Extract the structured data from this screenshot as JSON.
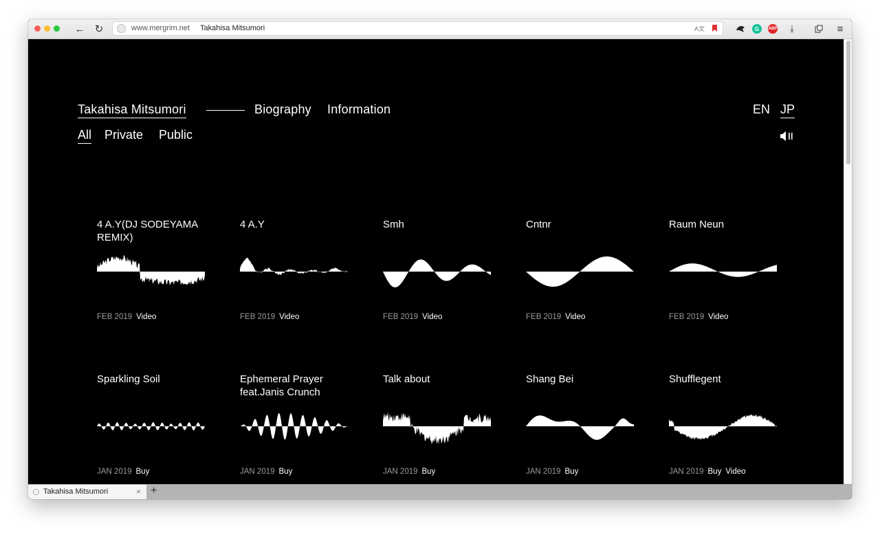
{
  "browser": {
    "url_domain": "www.mergrim.net",
    "url_title": "Takahisa Mitsumori",
    "translate_glyph": "A文",
    "ext_grammarly": "G",
    "ext_abp": "ABP",
    "tab_title": "Takahisa Mitsumori",
    "back_glyph": "←",
    "reload_glyph": "↻",
    "download_glyph": "⤓",
    "menu_glyph": "≡",
    "close_glyph": "×",
    "newtab_glyph": "+"
  },
  "nav": {
    "artist": "Takahisa Mitsumori",
    "biography": "Biography",
    "information": "Information",
    "lang_en": "EN",
    "lang_jp": "JP"
  },
  "filters": {
    "all": "All",
    "private": "Private",
    "public": "Public"
  },
  "colors": {
    "background": "#000000",
    "text": "#ffffff",
    "meta_date": "#9a9a9a"
  },
  "works": [
    {
      "title": "4 A.Y(DJ SODEYAMA REMIX)",
      "date": "FEB 2019",
      "tags": [
        "Video"
      ],
      "wave": "noisy-up-down"
    },
    {
      "title": "4 A.Y",
      "date": "FEB 2019",
      "tags": [
        "Video"
      ],
      "wave": "spiky-mixed"
    },
    {
      "title": "Smh",
      "date": "FEB 2019",
      "tags": [
        "Video"
      ],
      "wave": "decaying-sine"
    },
    {
      "title": "Cntnr",
      "date": "FEB 2019",
      "tags": [
        "Video"
      ],
      "wave": "inverted-sine"
    },
    {
      "title": "Raum Neun",
      "date": "FEB 2019",
      "tags": [
        "Video"
      ],
      "wave": "gentle-sine"
    },
    {
      "title": "Sparkling Soil",
      "date": "JAN 2019",
      "tags": [
        "Buy"
      ],
      "wave": "small-ripple"
    },
    {
      "title": "Ephemeral Prayer feat.Janis Crunch",
      "date": "JAN 2019",
      "tags": [
        "Buy"
      ],
      "wave": "amplitude-burst"
    },
    {
      "title": "Talk about",
      "date": "JAN 2019",
      "tags": [
        "Buy"
      ],
      "wave": "noisy-dip"
    },
    {
      "title": "Shang Bei",
      "date": "JAN 2019",
      "tags": [
        "Buy"
      ],
      "wave": "lumpy-mixed"
    },
    {
      "title": "Shufflegent",
      "date": "JAN 2019",
      "tags": [
        "Buy",
        "Video"
      ],
      "wave": "down-up"
    }
  ]
}
